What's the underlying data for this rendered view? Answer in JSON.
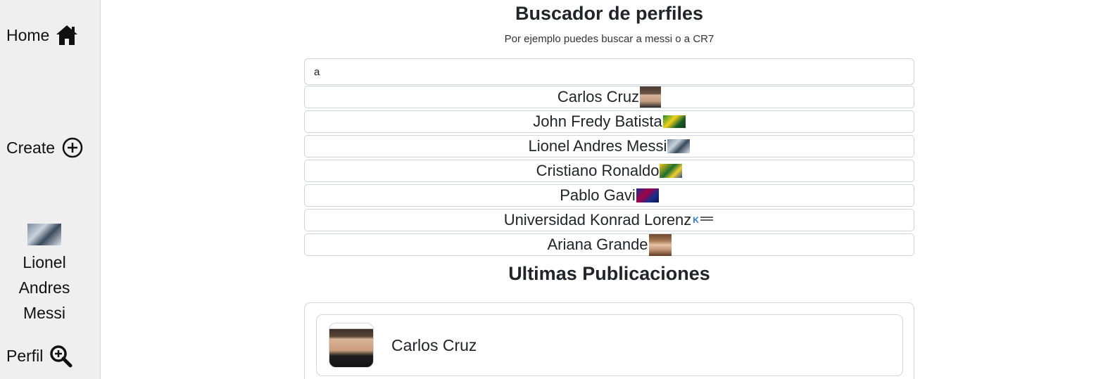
{
  "sidebar": {
    "home_label": "Home",
    "create_label": "Create",
    "profile_name": "Lionel Andres Messi",
    "perfil_label": "Perfil"
  },
  "search": {
    "title": "Buscador de perfiles",
    "subtitle": "Por ejemplo puedes buscar a messi o a CR7",
    "query": "a",
    "results": [
      {
        "name": "Carlos Cruz"
      },
      {
        "name": "John Fredy Batista"
      },
      {
        "name": "Lionel Andres Messi"
      },
      {
        "name": "Cristiano Ronaldo"
      },
      {
        "name": "Pablo Gavi"
      },
      {
        "name": "Universidad Konrad Lorenz"
      },
      {
        "name": "Ariana Grande"
      }
    ]
  },
  "feed": {
    "title": "Ultimas Publicaciones",
    "posts": [
      {
        "author": "Carlos Cruz"
      }
    ]
  },
  "icons": {
    "home": "home-icon",
    "create": "plus-circle-icon",
    "perfil": "search-icon"
  }
}
